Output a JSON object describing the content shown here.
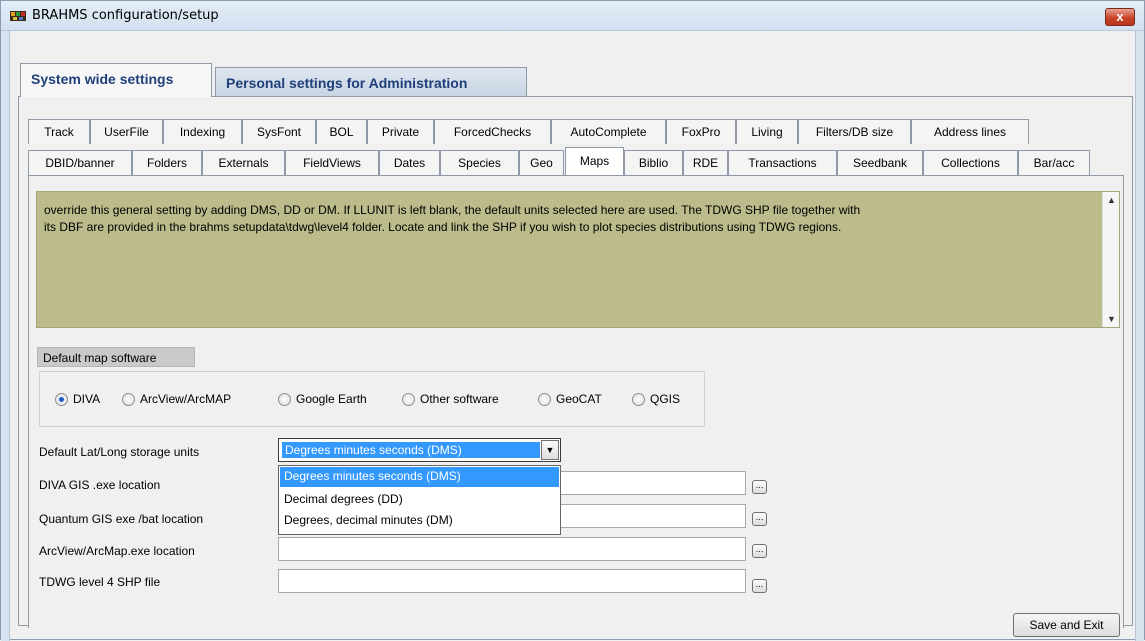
{
  "window": {
    "title": "BRAHMS configuration/setup",
    "close_label": "x"
  },
  "top_tabs": [
    {
      "label": "System wide settings",
      "active": true
    },
    {
      "label": "Personal settings for Administration",
      "active": false
    }
  ],
  "sub_tabs_row1": [
    "Track",
    "UserFile",
    "Indexing",
    "SysFont",
    "BOL",
    "Private",
    "ForcedChecks",
    "AutoComplete",
    "FoxPro",
    "Living",
    "Filters/DB size",
    "Address lines"
  ],
  "sub_tabs_row2": [
    "DBID/banner",
    "Folders",
    "Externals",
    "FieldViews",
    "Dates",
    "Species",
    "Geo",
    "Maps",
    "Biblio",
    "RDE",
    "Transactions",
    "Seedbank",
    "Collections",
    "Bar/acc"
  ],
  "active_sub_tab": "Maps",
  "info": {
    "line1": "override this general setting by adding DMS, DD or DM.  If LLUNIT is left blank, the default units selected here are used. The TDWG SHP file together with",
    "line2": "its DBF are provided in the brahms setupdata\\tdwg\\level4 folder. Locate and link the SHP if you wish to plot species distributions using TDWG regions."
  },
  "map_software": {
    "label": "Default map software",
    "options": [
      "DIVA",
      "ArcView/ArcMAP",
      "Google Earth",
      "Other software",
      "GeoCAT",
      "QGIS"
    ],
    "selected": "DIVA"
  },
  "storage_units": {
    "label": "Default Lat/Long storage units",
    "value": "Degrees minutes seconds (DMS)",
    "options": [
      "Degrees minutes seconds (DMS)",
      "Decimal degrees (DD)",
      "Degrees, decimal minutes (DM)"
    ]
  },
  "fields": {
    "diva_label": "DIVA GIS .exe location",
    "qgis_label": "Quantum GIS exe /bat location",
    "arcview_label": "ArcView/ArcMap.exe location",
    "tdwg_label": "TDWG level 4 SHP file",
    "browse_label": "..."
  },
  "buttons": {
    "save_exit": "Save and Exit"
  },
  "colors": {
    "info_bg": "#bcbb8b",
    "selection": "#3399ff",
    "tab_text": "#1f3f7a"
  }
}
